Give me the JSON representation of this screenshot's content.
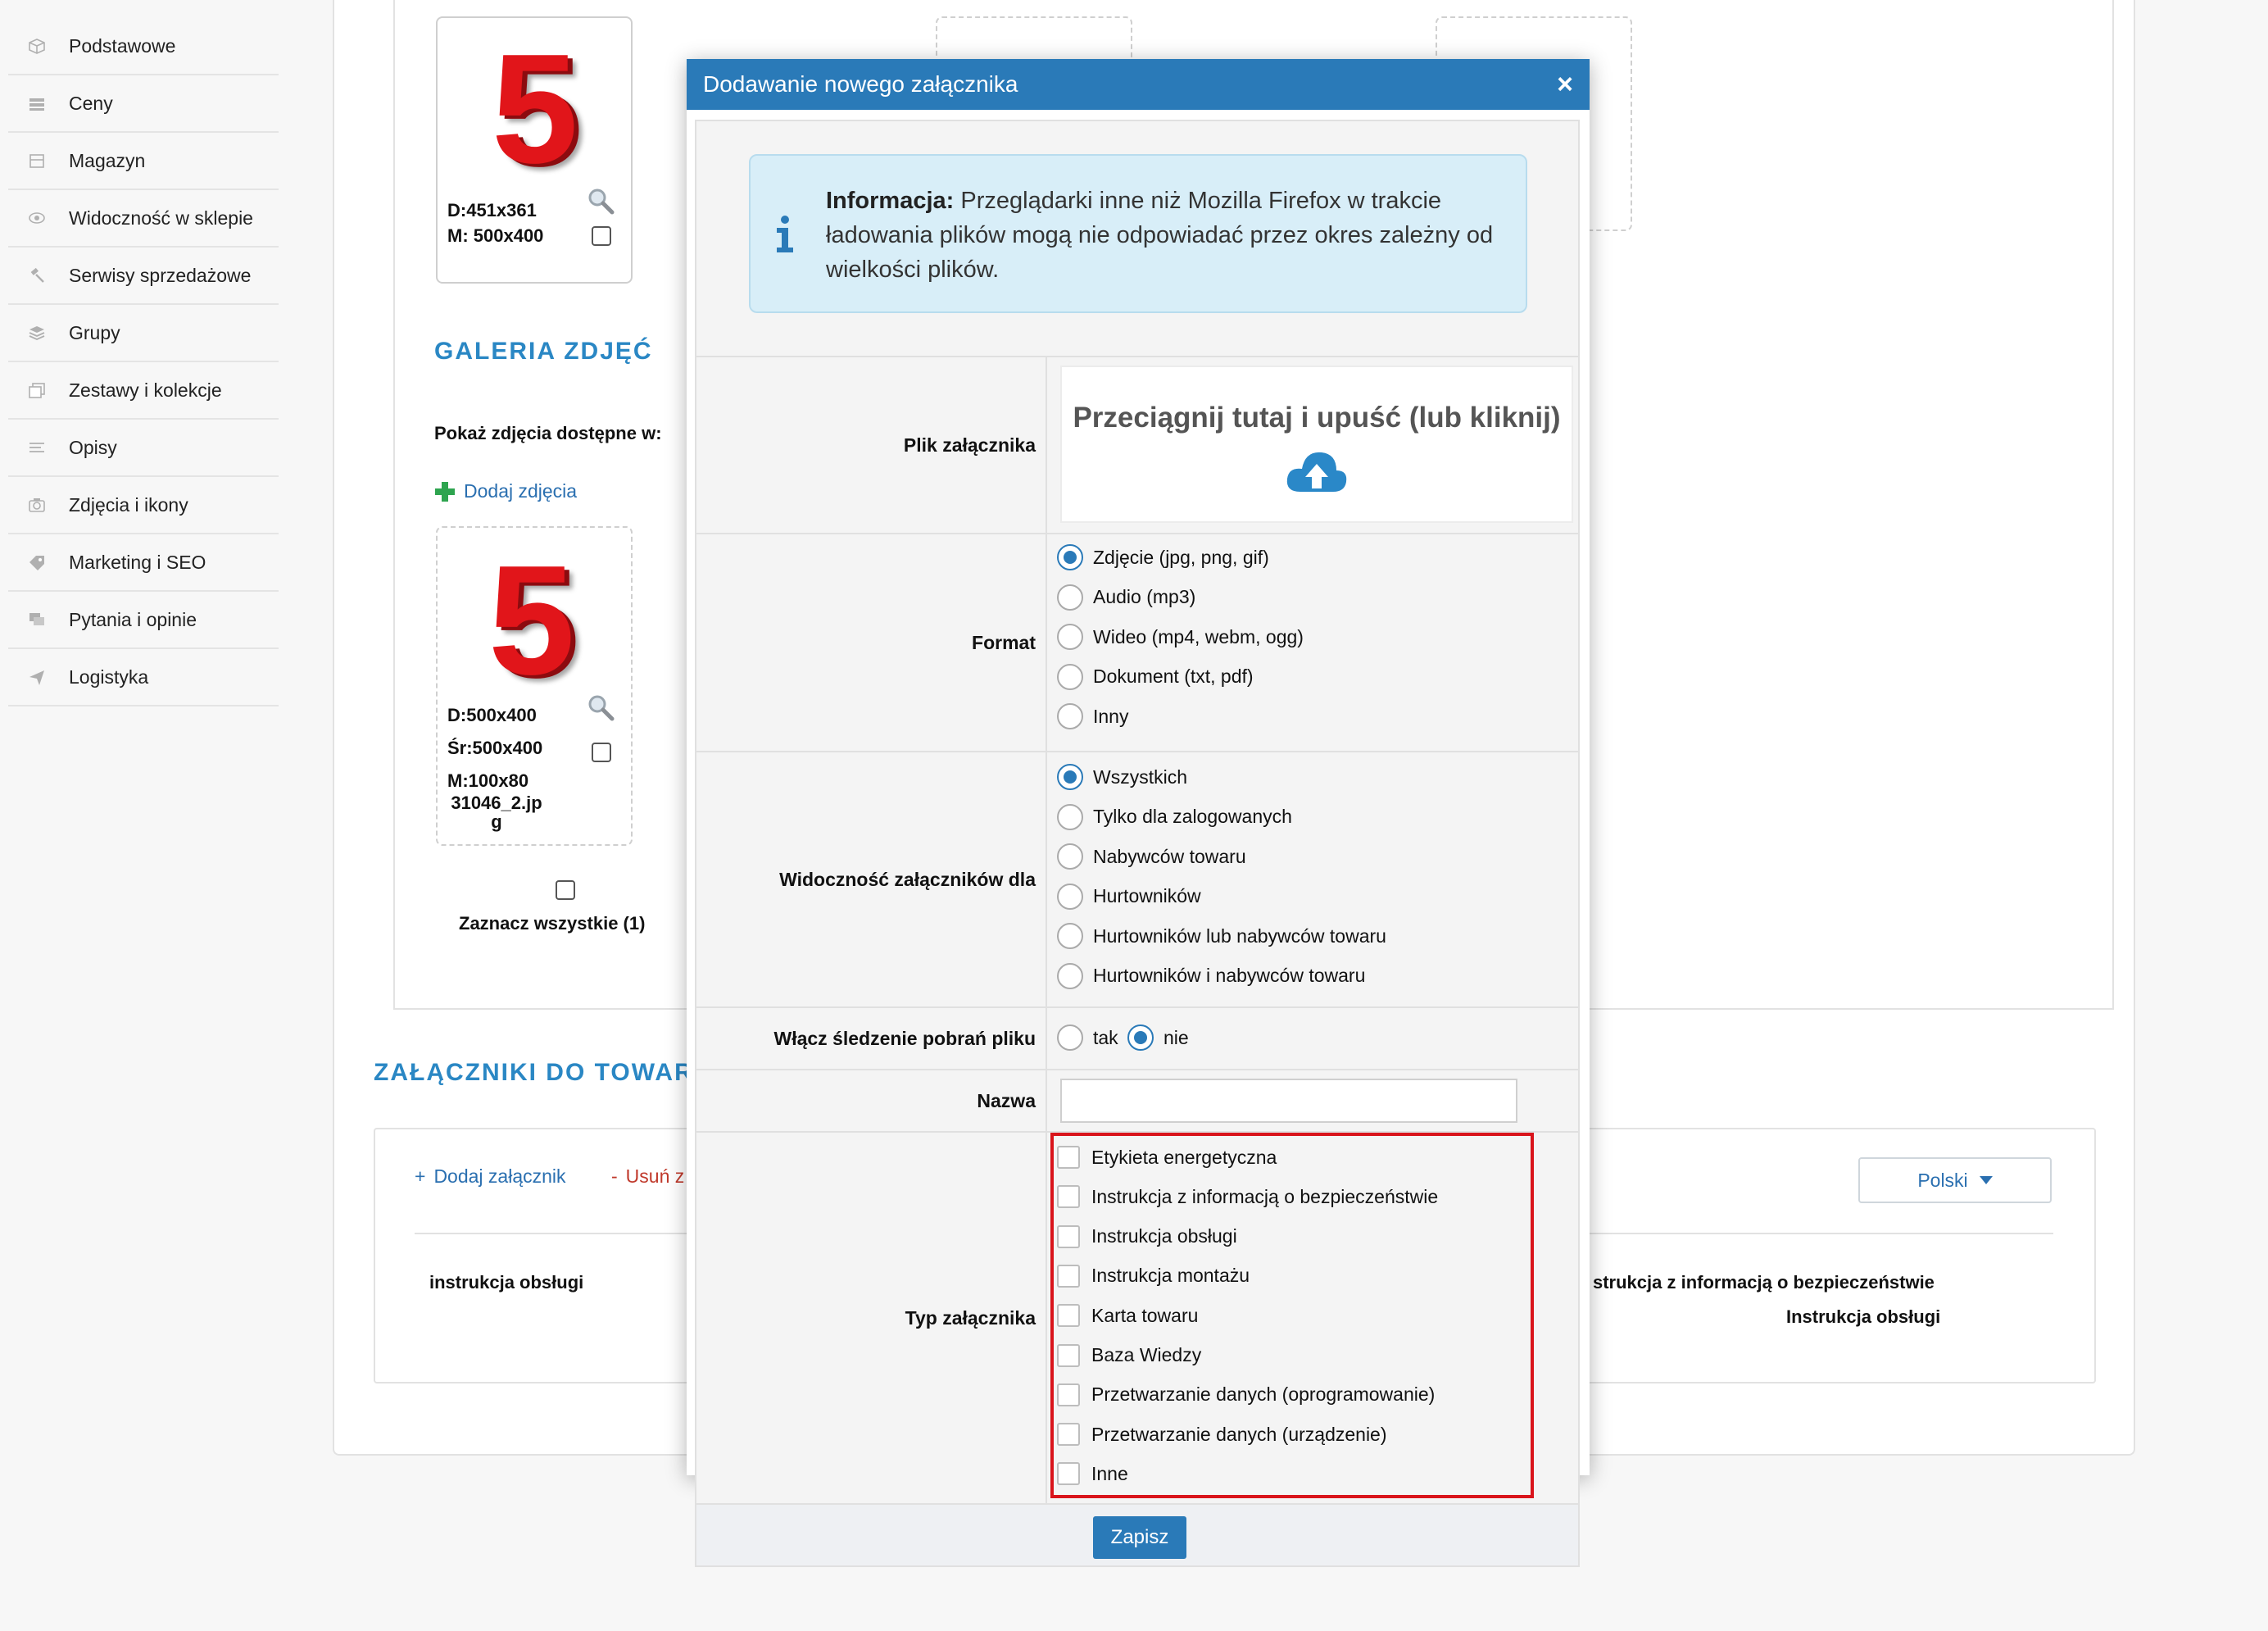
{
  "sidebar": {
    "items": [
      {
        "label": "Podstawowe",
        "icon": "cube-icon"
      },
      {
        "label": "Ceny",
        "icon": "money-icon"
      },
      {
        "label": "Magazyn",
        "icon": "warehouse-icon"
      },
      {
        "label": "Widoczność w sklepie",
        "icon": "eye-icon"
      },
      {
        "label": "Serwisy sprzedażowe",
        "icon": "gavel-icon"
      },
      {
        "label": "Grupy",
        "icon": "layers-icon"
      },
      {
        "label": "Zestawy i kolekcje",
        "icon": "collection-icon"
      },
      {
        "label": "Opisy",
        "icon": "text-lines-icon"
      },
      {
        "label": "Zdjęcia i ikony",
        "icon": "camera-icon"
      },
      {
        "label": "Marketing i SEO",
        "icon": "tag-icon"
      },
      {
        "label": "Pytania i opinie",
        "icon": "chat-icon"
      },
      {
        "label": "Logistyka",
        "icon": "send-icon"
      }
    ]
  },
  "main_image": {
    "digit": "5",
    "dims_line1": "D:451x361",
    "dims_line2": "M: 500x400"
  },
  "gallery": {
    "title": "GALERIA ZDJĘĆ",
    "show_label": "Pokaż zdjęcia dostępne w:",
    "add_photos": "Dodaj zdjęcia",
    "photo": {
      "digit": "5",
      "d": "D:500x400",
      "sr": "Śr:500x400",
      "m": "M:100x80",
      "filename": "31046_2.jpg"
    },
    "select_all": "Zaznacz wszystkie (1)"
  },
  "attachments": {
    "title": "ZAŁĄCZNIKI DO TOWARÓW",
    "add_link": "Dodaj załącznik",
    "remove_link": "Usuń z",
    "language": "Polski",
    "row_name": "instrukcja obsługi",
    "right_type_1": "strukcja z informacją o bezpieczeństwie",
    "right_type_2": "Instrukcja obsługi"
  },
  "modal": {
    "title": "Dodawanie nowego załącznika",
    "close": "×",
    "info_bold": "Informacja:",
    "info_text": " Przeglądarki inne niż Mozilla Firefox w trakcie ładowania plików mogą nie odpowiadać przez okres zależny od wielkości plików.",
    "file_label": "Plik załącznika",
    "drop_text": "Przeciągnij tutaj i upuść (lub kliknij)",
    "format_label": "Format",
    "format_options": [
      "Zdjęcie (jpg, png, gif)",
      "Audio (mp3)",
      "Wideo (mp4, webm, ogg)",
      "Dokument (txt, pdf)",
      "Inny"
    ],
    "format_selected": "Zdjęcie (jpg, png, gif)",
    "visibility_label": "Widoczność załączników dla",
    "visibility_options": [
      "Wszystkich",
      "Tylko dla zalogowanych",
      "Nabywców towaru",
      "Hurtowników",
      "Hurtowników lub nabywców towaru",
      "Hurtowników i nabywców towaru"
    ],
    "visibility_selected": "Wszystkich",
    "tracking_label": "Włącz śledzenie pobrań pliku",
    "tracking_yes": "tak",
    "tracking_no": "nie",
    "tracking_selected": "nie",
    "name_label": "Nazwa",
    "name_value": "",
    "type_label": "Typ załącznika",
    "type_options": [
      "Etykieta energetyczna",
      "Instrukcja z informacją o bezpieczeństwie",
      "Instrukcja obsługi",
      "Instrukcja montażu",
      "Karta towaru",
      "Baza Wiedzy",
      "Przetwarzanie danych (oprogramowanie)",
      "Przetwarzanie danych (urządzenie)",
      "Inne"
    ],
    "save": "Zapisz"
  },
  "colors": {
    "accent": "#2a7ab8",
    "highlight": "#d9141b",
    "info_bg": "#d8eef8",
    "green_plus": "#2ea44f"
  }
}
